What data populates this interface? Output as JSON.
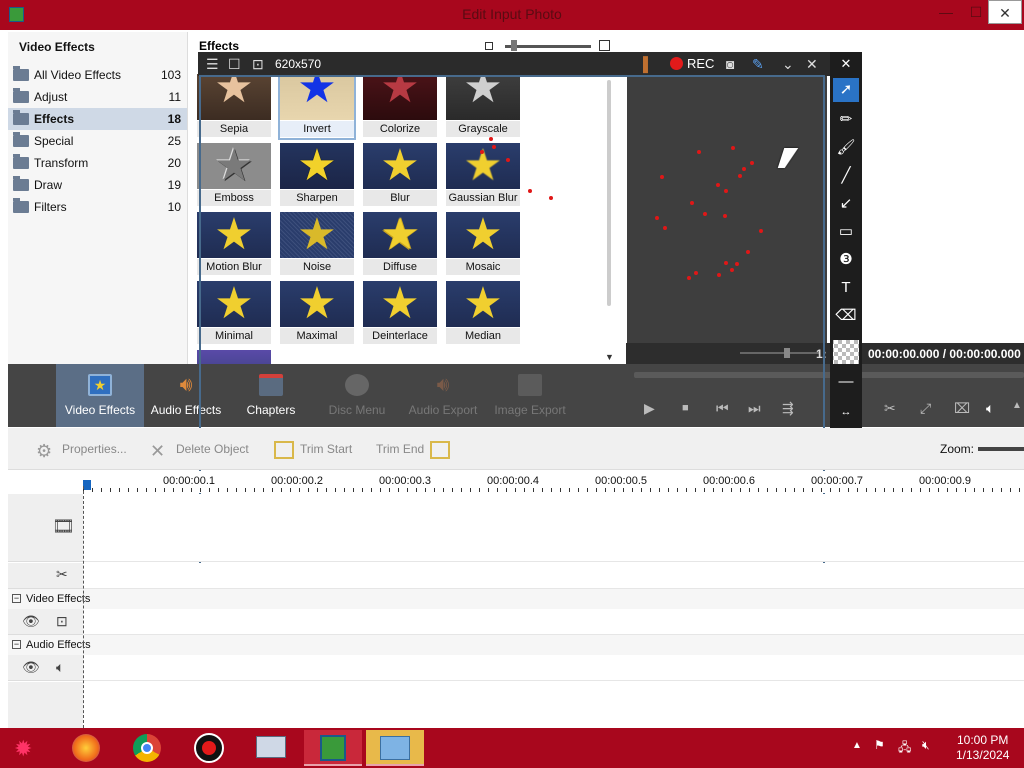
{
  "window": {
    "title": "Edit Input Photo",
    "minimize": "—",
    "maximize": "☐",
    "close": "✕"
  },
  "video_effects_panel": {
    "header": "Video Effects",
    "categories": [
      {
        "label": "All Video Effects",
        "count": "103"
      },
      {
        "label": "Adjust",
        "count": "11"
      },
      {
        "label": "Effects",
        "count": "18"
      },
      {
        "label": "Special",
        "count": "25"
      },
      {
        "label": "Transform",
        "count": "20"
      },
      {
        "label": "Draw",
        "count": "19"
      },
      {
        "label": "Filters",
        "count": "10"
      }
    ]
  },
  "effects_panel": {
    "header": "Effects",
    "tiles": [
      {
        "label": "Sepia"
      },
      {
        "label": "Invert"
      },
      {
        "label": "Colorize"
      },
      {
        "label": "Grayscale"
      },
      {
        "label": "Emboss"
      },
      {
        "label": "Sharpen"
      },
      {
        "label": "Blur"
      },
      {
        "label": "Gaussian Blur"
      },
      {
        "label": "Motion Blur"
      },
      {
        "label": "Noise"
      },
      {
        "label": "Diffuse"
      },
      {
        "label": "Mosaic"
      },
      {
        "label": "Minimal"
      },
      {
        "label": "Maximal"
      },
      {
        "label": "Deinterlace"
      },
      {
        "label": "Median"
      }
    ]
  },
  "recorder": {
    "size_readout": "620x570",
    "rec_label": "REC"
  },
  "preview": {
    "time_readout": "00:00:00.000 / 00:00:00.000",
    "time_prefix": "1:"
  },
  "main_tabs": [
    {
      "label": "Video Effects"
    },
    {
      "label": "Audio Effects"
    },
    {
      "label": "Chapters"
    },
    {
      "label": "Disc Menu"
    },
    {
      "label": "Audio Export"
    },
    {
      "label": "Image Export"
    }
  ],
  "tools": {
    "properties": "Properties...",
    "delete_object": "Delete Object",
    "trim_start": "Trim Start",
    "trim_end": "Trim End",
    "zoom_label": "Zoom:"
  },
  "timeline": {
    "ticks": [
      "00:00:00.1",
      "00:00:00.2",
      "00:00:00.3",
      "00:00:00.4",
      "00:00:00.5",
      "00:00:00.6",
      "00:00:00.7",
      "00:00:00.9"
    ],
    "video_effects_section": "Video Effects",
    "audio_effects_section": "Audio Effects"
  },
  "taskbar": {
    "time": "10:00 PM",
    "date": "1/13/2024"
  },
  "colors": {
    "titlebar": "#a8071d",
    "selected_tab": "#5b6e86",
    "record_red": "#e21a1a",
    "capture_frame": "#476a8c"
  }
}
